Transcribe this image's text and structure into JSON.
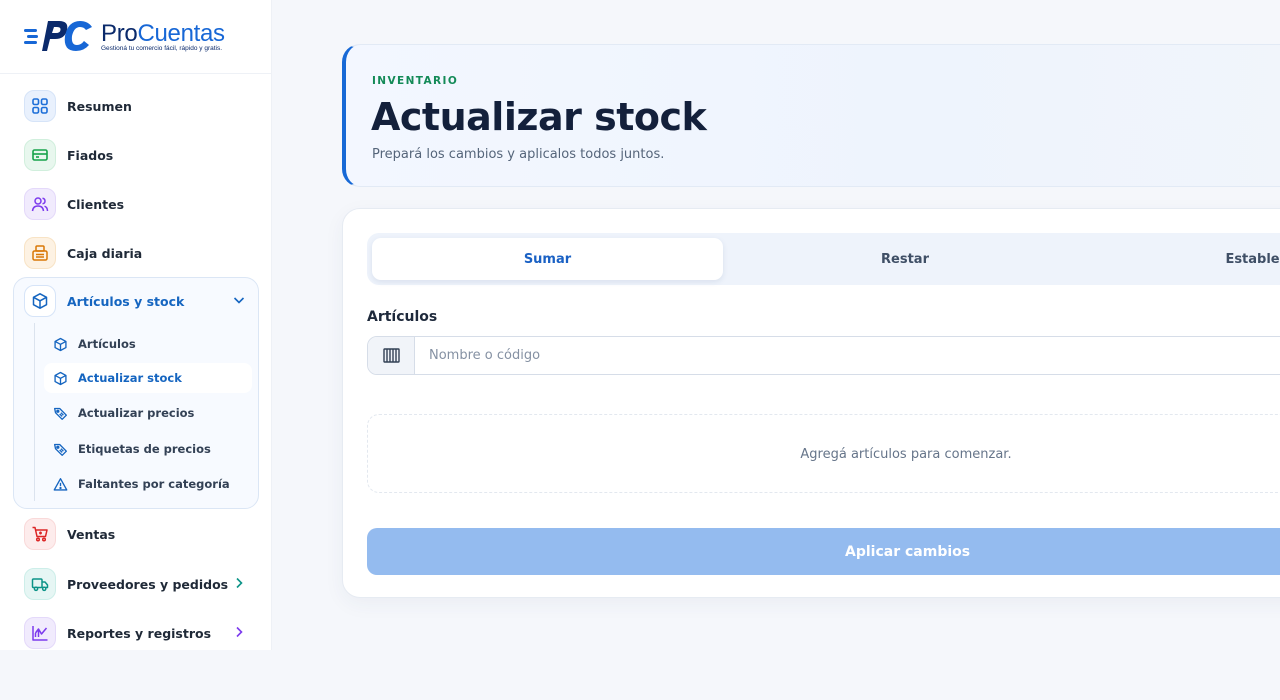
{
  "brand": {
    "name_part1": "Pro",
    "name_part2": "Cuentas",
    "tagline": "Gestioná tu comercio fácil, rápido y gratis.",
    "logo_text": "PC"
  },
  "sidebar": {
    "items": [
      {
        "label": "Resumen",
        "icon": "grid-icon",
        "color": "#1d6fd8"
      },
      {
        "label": "Fiados",
        "icon": "card-icon",
        "color": "#16a34a"
      },
      {
        "label": "Clientes",
        "icon": "users-icon",
        "color": "#7c3aed"
      },
      {
        "label": "Caja diaria",
        "icon": "cash-register-icon",
        "color": "#d97706"
      },
      {
        "label": "Artículos y stock",
        "icon": "box-icon",
        "color": "#1565c0",
        "expanded": true
      },
      {
        "label": "Ventas",
        "icon": "cart-icon",
        "color": "#dc2626"
      },
      {
        "label": "Proveedores y pedidos",
        "icon": "truck-icon",
        "color": "#0d9488"
      },
      {
        "label": "Reportes y registros",
        "icon": "chart-icon",
        "color": "#7c3aed"
      }
    ],
    "sub_items": [
      {
        "label": "Artículos",
        "icon": "box-icon"
      },
      {
        "label": "Actualizar stock",
        "icon": "box-icon",
        "active": true
      },
      {
        "label": "Actualizar precios",
        "icon": "price-tag-icon"
      },
      {
        "label": "Etiquetas de precios",
        "icon": "price-tag-icon"
      },
      {
        "label": "Faltantes por categoría",
        "icon": "warning-icon"
      }
    ]
  },
  "header": {
    "eyebrow": "INVENTARIO",
    "title": "Actualizar stock",
    "subtitle": "Prepará los cambios y aplicalos todos juntos."
  },
  "tabs": [
    {
      "label": "Sumar",
      "active": true
    },
    {
      "label": "Restar",
      "active": false
    },
    {
      "label": "Establecer",
      "active": false
    }
  ],
  "articles": {
    "label": "Artículos",
    "placeholder": "Nombre o código",
    "value": "",
    "empty_text": "Agregá artículos para comenzar."
  },
  "apply_button": "Aplicar cambios",
  "colors": {
    "accent": "#1769d6",
    "eyebrow": "#138a57",
    "button_disabled": "#94bbef"
  }
}
